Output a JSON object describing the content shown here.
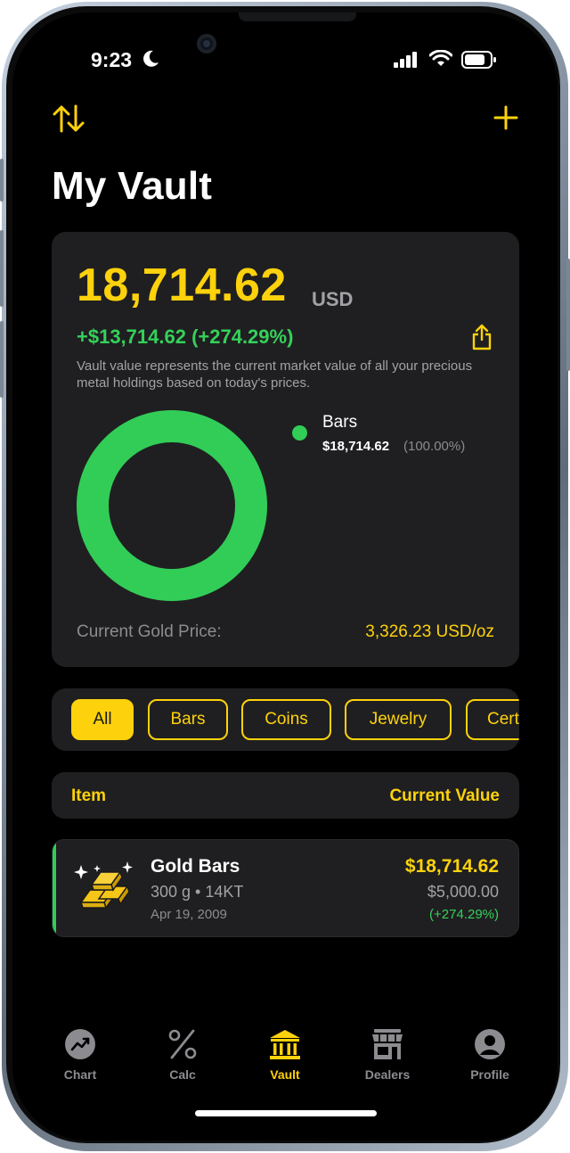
{
  "status_bar": {
    "time": "9:23",
    "focus_icon": "moon-icon",
    "signal_icon": "cellular-signal-icon",
    "wifi_icon": "wifi-icon",
    "battery_icon": "battery-icon"
  },
  "header": {
    "sort_icon": "sort-arrows-icon",
    "add_icon": "plus-icon",
    "title": "My Vault"
  },
  "summary": {
    "value": "18,714.62",
    "currency": "USD",
    "change": "+$13,714.62 (+274.29%)",
    "share_icon": "share-icon",
    "description": "Vault value represents the current market value of all your precious metal holdings based on today's prices.",
    "chart": {
      "legend_name": "Bars",
      "legend_amount": "$18,714.62",
      "legend_percent": "(100.00%)"
    },
    "gold_price_label": "Current Gold Price:",
    "gold_price_value": "3,326.23 USD/oz"
  },
  "chart_data": {
    "type": "pie",
    "categories": [
      "Bars"
    ],
    "values": [
      18714.62
    ],
    "legend_placement": "right"
  },
  "filters": {
    "chips": [
      {
        "label": "All",
        "selected": true
      },
      {
        "label": "Bars",
        "selected": false
      },
      {
        "label": "Coins",
        "selected": false
      },
      {
        "label": "Jewelry",
        "selected": false
      },
      {
        "label": "Certificates",
        "selected": false
      }
    ]
  },
  "table": {
    "item_header": "Item",
    "value_header": "Current Value"
  },
  "items": [
    {
      "icon": "gold-bars-icon",
      "name": "Gold Bars",
      "meta": "300 g • 14KT",
      "date": "Apr 19, 2009",
      "value": "$18,714.62",
      "cost": "$5,000.00",
      "change": "(+274.29%)"
    }
  ],
  "tabbar": {
    "tabs": [
      {
        "label": "Chart",
        "icon": "chart-icon",
        "active": false
      },
      {
        "label": "Calc",
        "icon": "percent-icon",
        "active": false
      },
      {
        "label": "Vault",
        "icon": "bank-icon",
        "active": true
      },
      {
        "label": "Dealers",
        "icon": "store-icon",
        "active": false
      },
      {
        "label": "Profile",
        "icon": "person-icon",
        "active": false
      }
    ]
  },
  "colors": {
    "accent": "#fdd20c",
    "positive": "#35d15a",
    "chart_bars": "#32cd57",
    "card": "#1f1f21",
    "background": "#000000"
  }
}
